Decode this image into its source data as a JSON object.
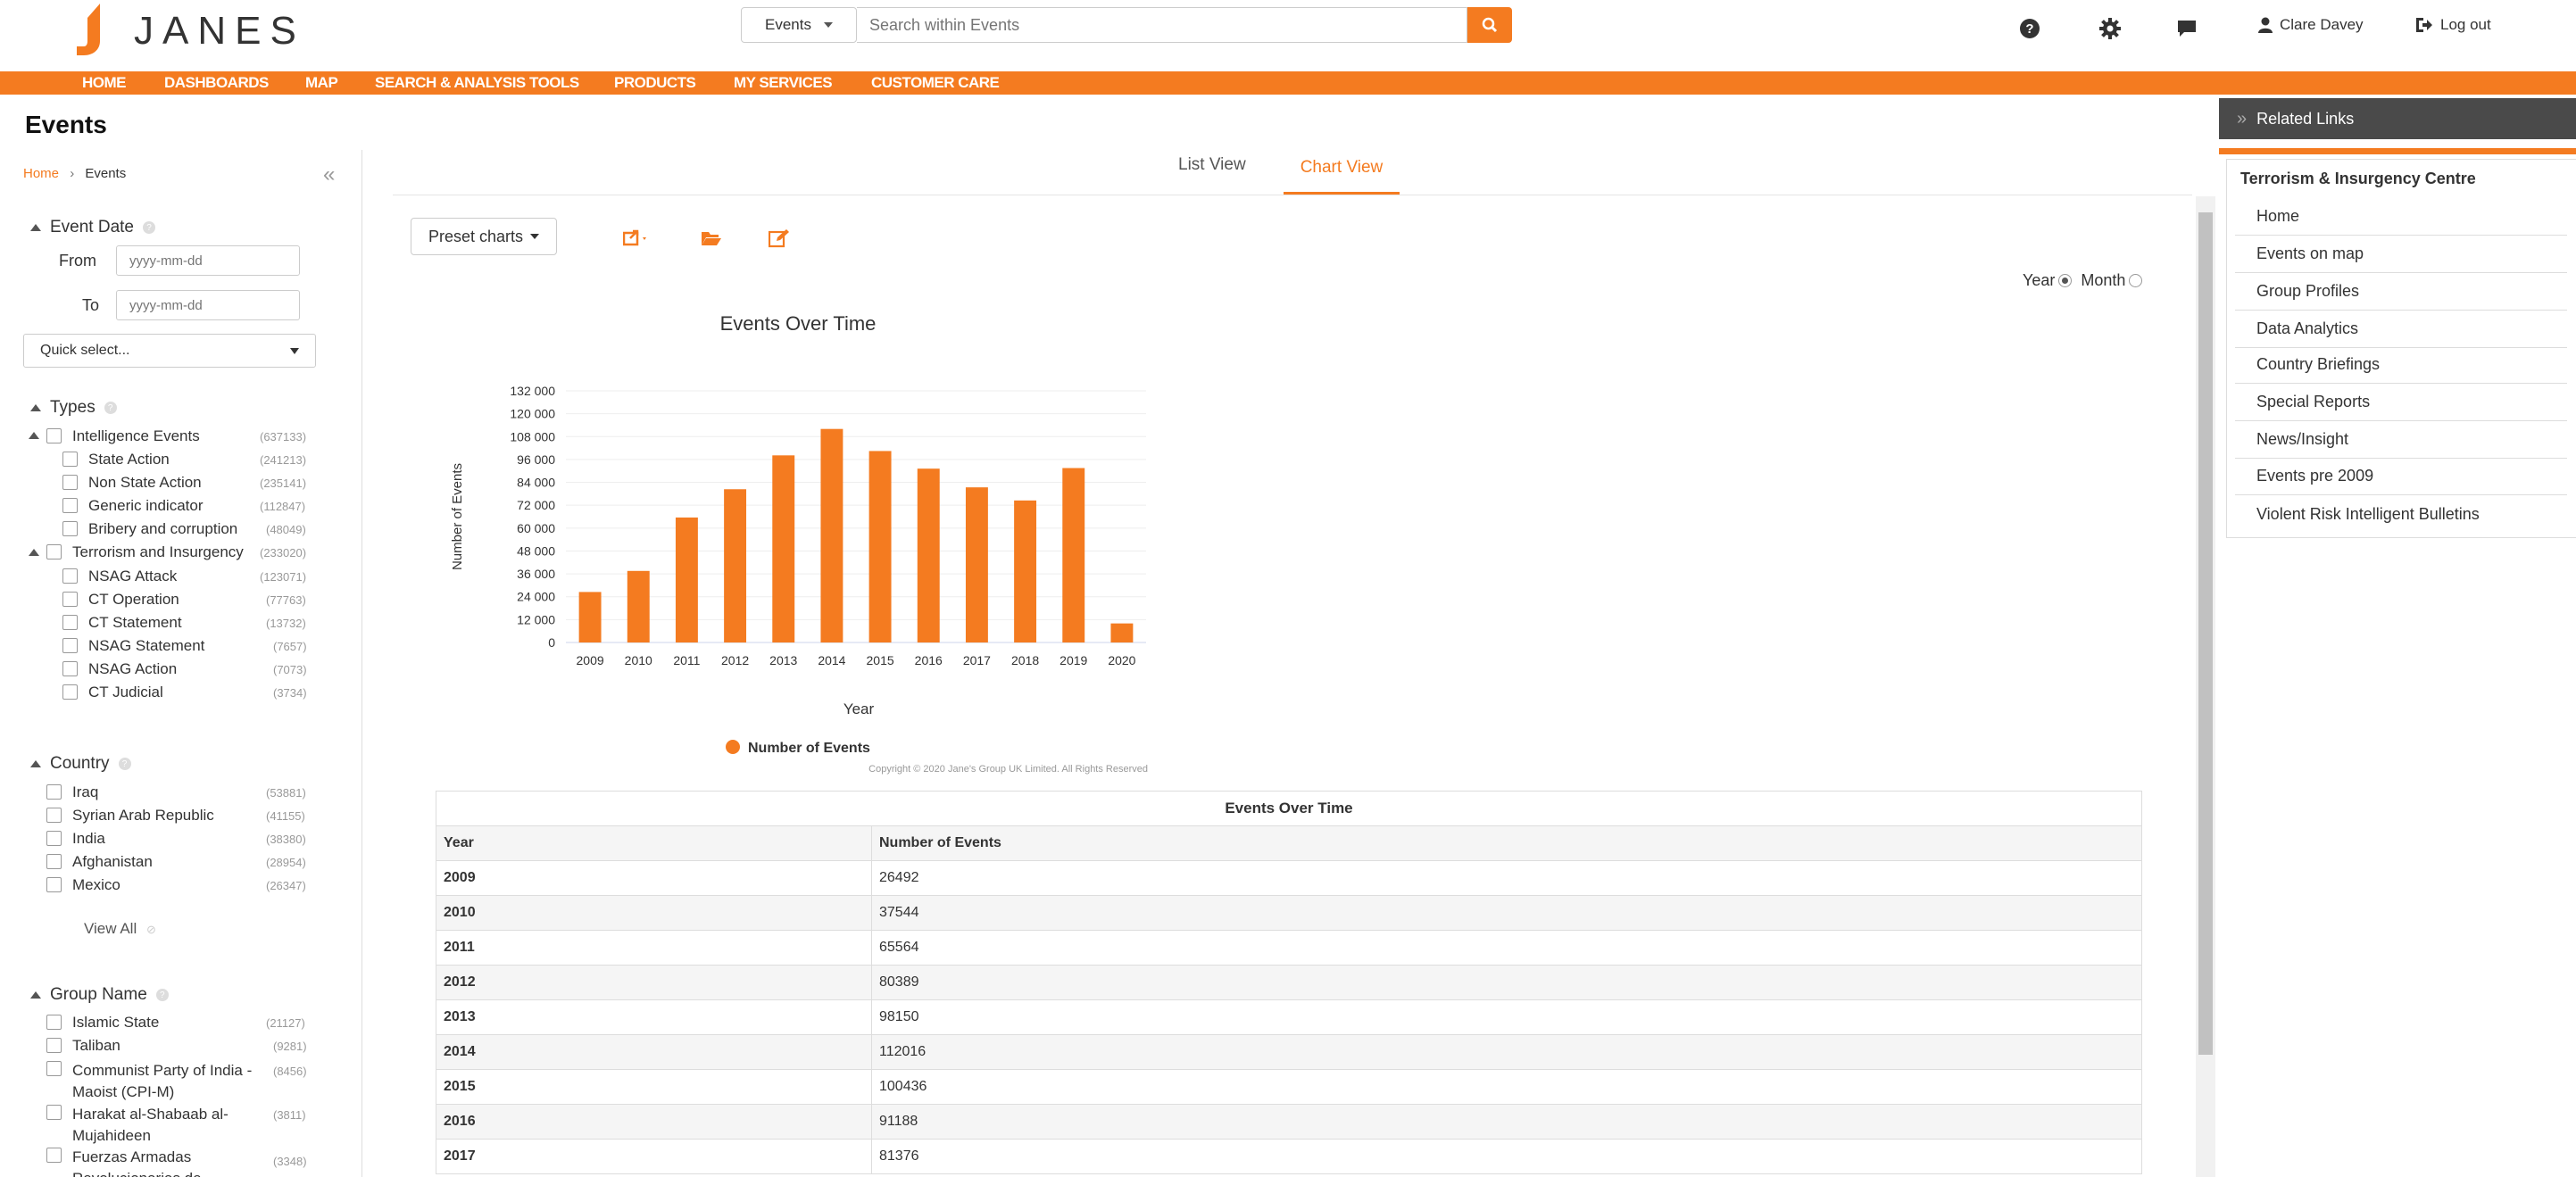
{
  "header": {
    "logo_text": "JANES",
    "search_scope": "Events",
    "search_placeholder": "Search within Events",
    "user_name": "Clare Davey",
    "logout_label": "Log out"
  },
  "nav": {
    "items": [
      "HOME",
      "DASHBOARDS",
      "MAP",
      "SEARCH & ANALYSIS TOOLS",
      "PRODUCTS",
      "MY SERVICES",
      "CUSTOMER CARE"
    ]
  },
  "page": {
    "title": "Events"
  },
  "sidebar": {
    "breadcrumb_home": "Home",
    "breadcrumb_current": "Events",
    "event_date": {
      "title": "Event Date",
      "from_label": "From",
      "to_label": "To",
      "from_placeholder": "yyyy-mm-dd",
      "to_placeholder": "yyyy-mm-dd",
      "quick_select": "Quick select..."
    },
    "types": {
      "title": "Types",
      "groups": [
        {
          "label": "Intelligence Events",
          "count": "(637133)",
          "children": [
            {
              "label": "State Action",
              "count": "(241213)"
            },
            {
              "label": "Non State Action",
              "count": "(235141)"
            },
            {
              "label": "Generic indicator",
              "count": "(112847)"
            },
            {
              "label": "Bribery and corruption",
              "count": "(48049)"
            }
          ]
        },
        {
          "label": "Terrorism and Insurgency",
          "count": "(233020)",
          "children": [
            {
              "label": "NSAG Attack",
              "count": "(123071)"
            },
            {
              "label": "CT Operation",
              "count": "(77763)"
            },
            {
              "label": "CT Statement",
              "count": "(13732)"
            },
            {
              "label": "NSAG Statement",
              "count": "(7657)"
            },
            {
              "label": "NSAG Action",
              "count": "(7073)"
            },
            {
              "label": "CT Judicial",
              "count": "(3734)"
            }
          ]
        }
      ]
    },
    "country": {
      "title": "Country",
      "items": [
        {
          "label": "Iraq",
          "count": "(53881)"
        },
        {
          "label": "Syrian Arab Republic",
          "count": "(41155)"
        },
        {
          "label": "India",
          "count": "(38380)"
        },
        {
          "label": "Afghanistan",
          "count": "(28954)"
        },
        {
          "label": "Mexico",
          "count": "(26347)"
        }
      ],
      "view_all": "View All"
    },
    "group_name": {
      "title": "Group Name",
      "items": [
        {
          "label": "Islamic State",
          "count": "(21127)"
        },
        {
          "label": "Taliban",
          "count": "(9281)"
        },
        {
          "label": "Communist Party of India - Maoist (CPI-M)",
          "count": "(8456)"
        },
        {
          "label": "Harakat al-Shabaab al-Mujahideen",
          "count": "(3811)"
        },
        {
          "label": "Fuerzas Armadas Revolucionarias de",
          "count": "(3348)"
        }
      ]
    }
  },
  "main": {
    "tabs": [
      "List View",
      "Chart View"
    ],
    "active_tab": "Chart View",
    "preset_label": "Preset charts",
    "period": {
      "year": "Year",
      "month": "Month",
      "selected": "Year"
    }
  },
  "chart_data": {
    "type": "bar",
    "title": "Events Over Time",
    "xlabel": "Year",
    "ylabel": "Number of Events",
    "categories": [
      "2009",
      "2010",
      "2011",
      "2012",
      "2013",
      "2014",
      "2015",
      "2016",
      "2017",
      "2018",
      "2019",
      "2020"
    ],
    "series": [
      {
        "name": "Number of Events",
        "values": [
          26492,
          37544,
          65564,
          80389,
          98150,
          112016,
          100436,
          91188,
          81376,
          74500,
          91500,
          10000
        ]
      }
    ],
    "ylim": [
      0,
      132000
    ],
    "yticks": [
      0,
      12000,
      24000,
      36000,
      48000,
      60000,
      72000,
      84000,
      96000,
      108000,
      120000,
      132000
    ],
    "ytick_labels": [
      "0",
      "12 000",
      "24 000",
      "36 000",
      "48 000",
      "60 000",
      "72 000",
      "84 000",
      "96 000",
      "108 000",
      "120 000",
      "132 000"
    ],
    "legend_position": "bottom",
    "color": "#f47b20",
    "credit": "Copyright © 2020 Jane's Group UK Limited. All Rights Reserved"
  },
  "table": {
    "caption": "Events Over Time",
    "headers": [
      "Year",
      "Number of Events"
    ],
    "rows": [
      [
        "2009",
        "26492"
      ],
      [
        "2010",
        "37544"
      ],
      [
        "2011",
        "65564"
      ],
      [
        "2012",
        "80389"
      ],
      [
        "2013",
        "98150"
      ],
      [
        "2014",
        "112016"
      ],
      [
        "2015",
        "100436"
      ],
      [
        "2016",
        "91188"
      ],
      [
        "2017",
        "81376"
      ]
    ]
  },
  "related": {
    "header": "Related Links",
    "title": "Terrorism & Insurgency Centre",
    "links": [
      "Home",
      "Events on map",
      "Group Profiles",
      "Data Analytics",
      "Country Briefings",
      "Special Reports",
      "News/Insight",
      "Events pre 2009",
      "Violent Risk Intelligent Bulletins"
    ]
  },
  "colors": {
    "accent": "#f47b20",
    "panel_dark": "#4a4a4a"
  },
  "icons": [
    "search-icon",
    "help-icon",
    "gear-icon",
    "chat-icon",
    "user-icon",
    "logout-icon",
    "collapse-icon",
    "export-icon",
    "folder-icon",
    "edit-icon",
    "chevron-right-icon"
  ]
}
